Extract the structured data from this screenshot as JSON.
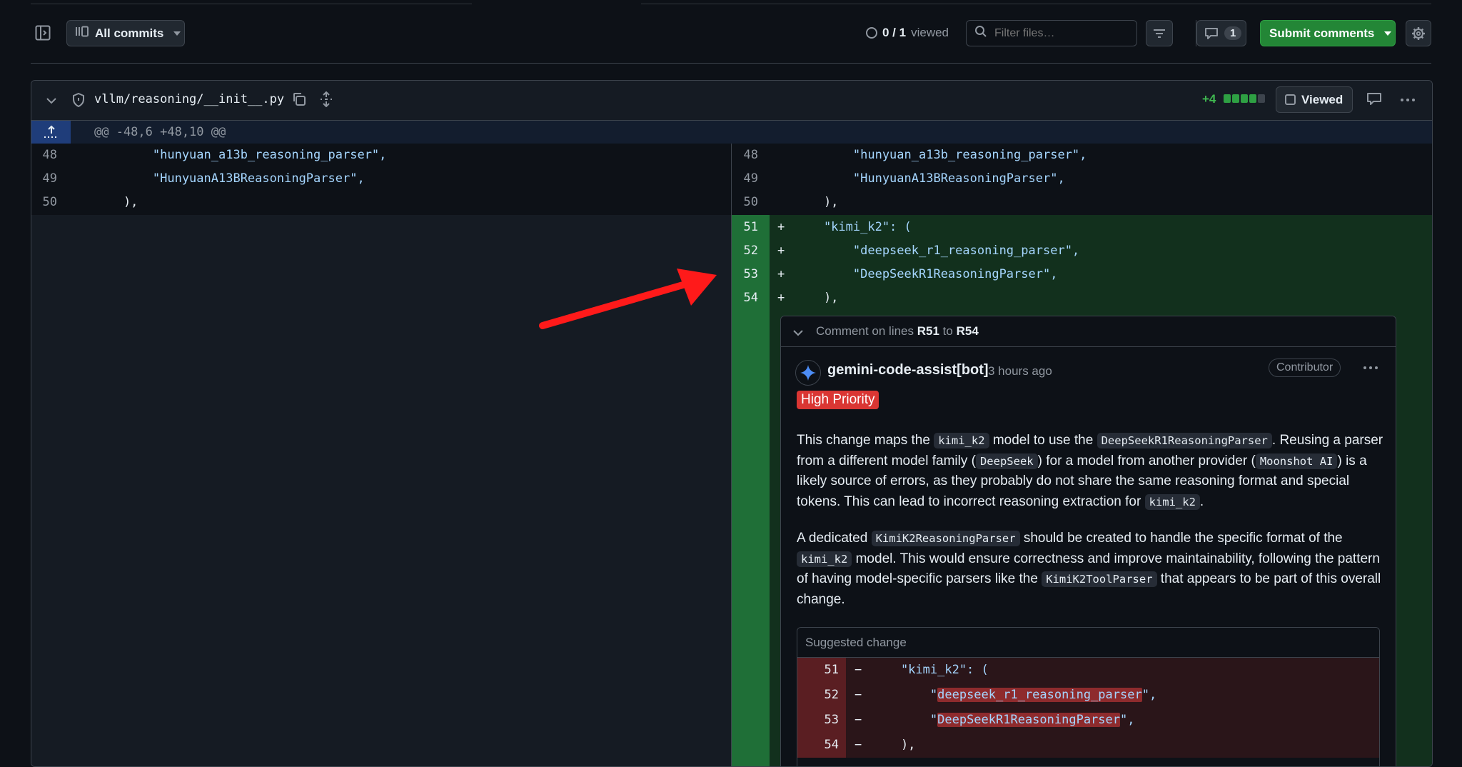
{
  "toolbar": {
    "commits_label": "All commits",
    "viewed_count": "0 / 1",
    "viewed_suffix": "viewed",
    "filter_placeholder": "Filter files…",
    "comments_count": "1",
    "submit_label": "Submit comments"
  },
  "file": {
    "path": "vllm/reasoning/__init__.py",
    "additions": "+4",
    "viewed_label": "Viewed",
    "hunk_header": "@@ -48,6 +48,10 @@"
  },
  "diff": {
    "context": [
      {
        "ln": "48",
        "text": "        \"hunyuan_a13b_reasoning_parser\","
      },
      {
        "ln": "49",
        "text": "        \"HunyuanA13BReasoningParser\","
      },
      {
        "ln": "50",
        "text": "    ),"
      }
    ],
    "added": [
      {
        "ln": "51",
        "sign": "+",
        "text": "    \"kimi_k2\": ("
      },
      {
        "ln": "52",
        "sign": "+",
        "text": "        \"deepseek_r1_reasoning_parser\","
      },
      {
        "ln": "53",
        "sign": "+",
        "text": "        \"DeepSeekR1ReasoningParser\","
      },
      {
        "ln": "54",
        "sign": "+",
        "text": "    ),"
      }
    ]
  },
  "thread": {
    "title_prefix": "Comment on lines",
    "range_start": "R51",
    "range_to": "to",
    "range_end": "R54",
    "author": "gemini-code-assist[bot]",
    "time": "3 hours ago",
    "role_badge": "Contributor",
    "priority_label": "High Priority",
    "p1": {
      "a": "This change maps the ",
      "c1": "kimi_k2",
      "b": " model to use the ",
      "c2": "DeepSeekR1ReasoningParser",
      "c": ". Reusing a parser from a different model family (",
      "c3": "DeepSeek",
      "d": ") for a model from another provider (",
      "c4": "Moonshot AI",
      "e": ") is a likely source of errors, as they probably do not share the same reasoning format and special tokens. This can lead to incorrect reasoning extraction for ",
      "c5": "kimi_k2",
      "f": "."
    },
    "p2": {
      "a": "A dedicated ",
      "c1": "KimiK2ReasoningParser",
      "b": " should be created to handle the specific format of the ",
      "c2": "kimi_k2",
      "c": " model. This would ensure correctness and improve maintainability, following the pattern of having model-specific parsers like the ",
      "c3": "KimiK2ToolParser",
      "d": " that appears to be part of this overall change."
    },
    "suggestion": {
      "header": "Suggested change",
      "lines": [
        {
          "ln": "51",
          "sign": "−",
          "pre": "    \"kimi_k2\": (",
          "hl": "",
          "post": ""
        },
        {
          "ln": "52",
          "sign": "−",
          "pre": "        \"",
          "hl": "deepseek_r1_reasoning_parser",
          "post": "\","
        },
        {
          "ln": "53",
          "sign": "−",
          "pre": "        \"",
          "hl": "DeepSeekR1ReasoningParser",
          "post": "\","
        },
        {
          "ln": "54",
          "sign": "−",
          "pre": "    ),",
          "hl": "",
          "post": ""
        }
      ]
    }
  },
  "colors": {
    "page_bg": "#0d1117",
    "added_bg": "#12301d",
    "added_gutter": "#1f6f37",
    "submit_green": "#238636",
    "priority_red": "#da3633",
    "arrow_red": "#ff1a1a"
  }
}
